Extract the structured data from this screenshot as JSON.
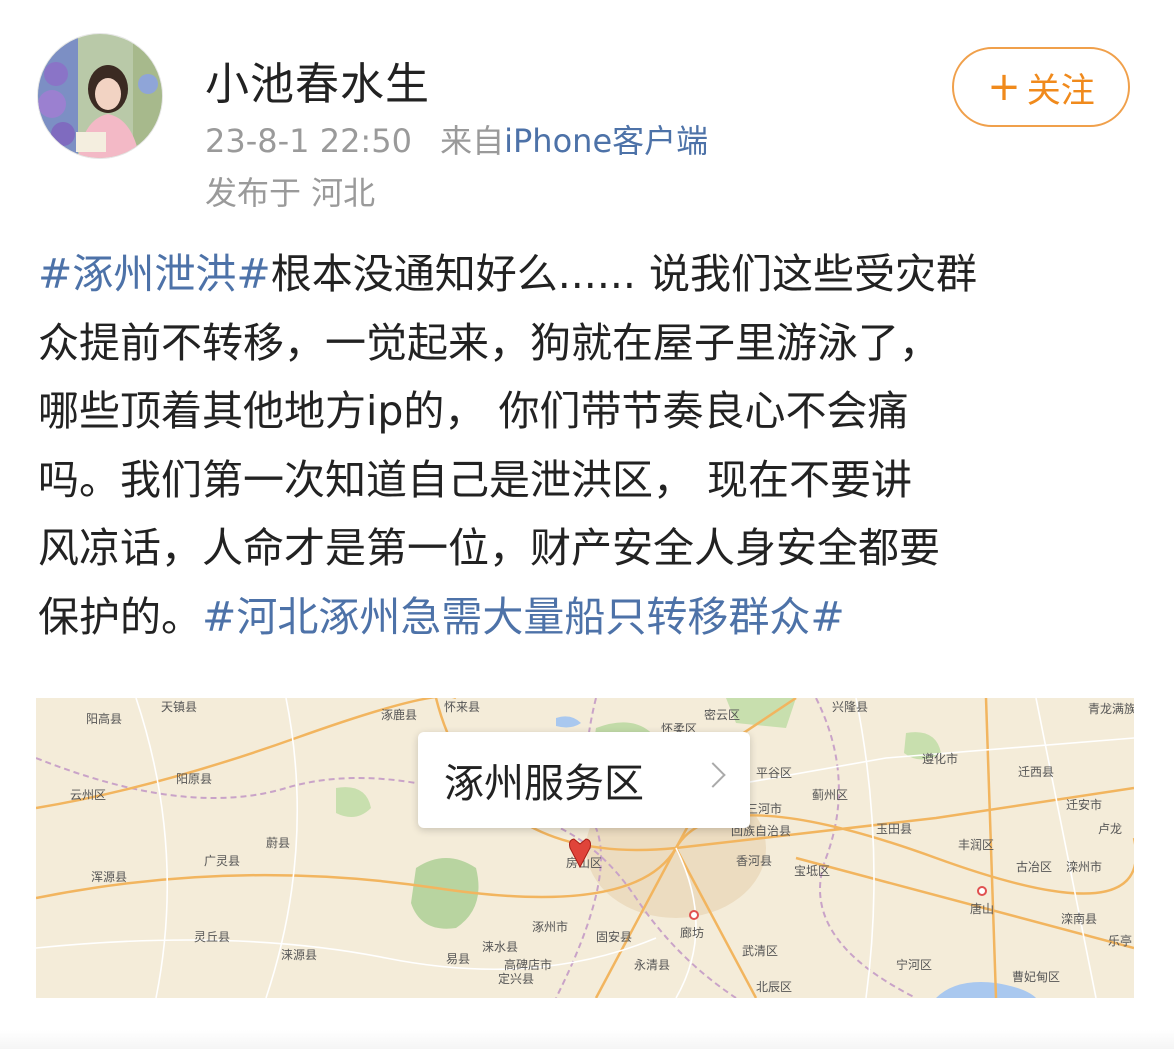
{
  "user": {
    "name": "小池春水生",
    "timestamp": "23-8-1 22:50",
    "source_prefix": "来自",
    "source_device": "iPhone客户端",
    "location": "发布于 河北"
  },
  "follow_button": {
    "plus": "+",
    "label": "关注"
  },
  "post": {
    "lines": [
      [
        {
          "t": "#涿州泄洪#",
          "tag": true
        },
        {
          "t": "根本没通知好么...... 说我们这些受灾群",
          "tag": false
        }
      ],
      [
        {
          "t": "众提前不转移，一觉起来，狗就在屋子里游泳了，",
          "tag": false
        }
      ],
      [
        {
          "t": "哪些顶着其他地方ip的， 你们带节奏良心不会痛",
          "tag": false
        }
      ],
      [
        {
          "t": "吗。我们第一次知道自己是泄洪区，  现在不要讲",
          "tag": false
        }
      ],
      [
        {
          "t": "风凉话，人命才是第一位，财产安全人身安全都要",
          "tag": false
        }
      ],
      [
        {
          "t": "保护的。",
          "tag": false
        },
        {
          "t": "#河北涿州急需大量船只转移群众#",
          "tag": true
        }
      ]
    ]
  },
  "map": {
    "poi_name": "涿州服务区",
    "labels": [
      {
        "id": "yanggao",
        "text": "阳高县"
      },
      {
        "id": "tianzhen",
        "text": "天镇县"
      },
      {
        "id": "zhuolu",
        "text": "涿鹿县"
      },
      {
        "id": "huailai",
        "text": "怀来县"
      },
      {
        "id": "huairou",
        "text": "怀柔区"
      },
      {
        "id": "miyun",
        "text": "密云区"
      },
      {
        "id": "xinglong",
        "text": "兴隆县"
      },
      {
        "id": "qinglong",
        "text": "青龙满族"
      },
      {
        "id": "yangyuan",
        "text": "阳原县"
      },
      {
        "id": "yunzhou",
        "text": "云州区"
      },
      {
        "id": "zunhua",
        "text": "遵化市"
      },
      {
        "id": "qianxi",
        "text": "迁西县"
      },
      {
        "id": "pinggu",
        "text": "平谷区"
      },
      {
        "id": "sanhe",
        "text": "三河市"
      },
      {
        "id": "jizhou",
        "text": "蓟州区"
      },
      {
        "id": "qian_an",
        "text": "迁安市"
      },
      {
        "id": "weixian",
        "text": "蔚县"
      },
      {
        "id": "dachang",
        "text": "回族自治县"
      },
      {
        "id": "yutian",
        "text": "玉田县"
      },
      {
        "id": "fengrun",
        "text": "丰润区"
      },
      {
        "id": "lulong",
        "text": "卢龙"
      },
      {
        "id": "guangling",
        "text": "广灵县"
      },
      {
        "id": "fangshan",
        "text": "房山区"
      },
      {
        "id": "xianghe",
        "text": "香河县"
      },
      {
        "id": "baodi",
        "text": "宝坻区"
      },
      {
        "id": "guye",
        "text": "古冶区"
      },
      {
        "id": "luanzhou",
        "text": "滦州市"
      },
      {
        "id": "hunyuan",
        "text": "浑源县"
      },
      {
        "id": "tangshan",
        "text": "唐山"
      },
      {
        "id": "zhuozhou",
        "text": "涿州市"
      },
      {
        "id": "gu_an",
        "text": "固安县"
      },
      {
        "id": "langfang",
        "text": "廊坊"
      },
      {
        "id": "luannan",
        "text": "滦南县"
      },
      {
        "id": "lingqiu",
        "text": "灵丘县"
      },
      {
        "id": "laishui",
        "text": "涞水县"
      },
      {
        "id": "wuqing",
        "text": "武清区"
      },
      {
        "id": "leting",
        "text": "乐亭"
      },
      {
        "id": "laiyuan",
        "text": "涞源县"
      },
      {
        "id": "yixian",
        "text": "易县"
      },
      {
        "id": "gaobeidian",
        "text": "高碑店市"
      },
      {
        "id": "yongqing",
        "text": "永清县"
      },
      {
        "id": "ninghe",
        "text": "宁河区"
      },
      {
        "id": "caofeidian",
        "text": "曹妃甸区"
      },
      {
        "id": "dingxing",
        "text": "定兴县"
      },
      {
        "id": "beichen",
        "text": "北辰区"
      }
    ]
  },
  "colors": {
    "hashtag": "#4d72a8",
    "follow": "#f08a1c",
    "meta": "#9a9a9a",
    "map_bg": "#f4ecd9"
  }
}
